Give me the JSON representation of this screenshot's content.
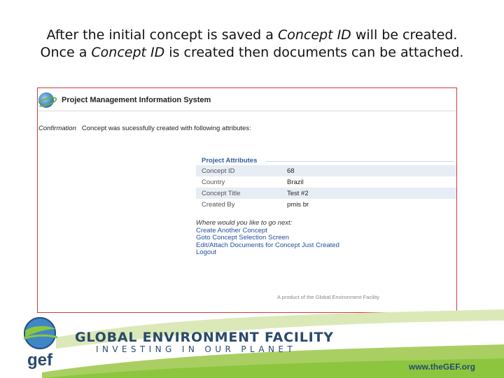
{
  "caption": {
    "line1_before": "After the initial concept is saved a ",
    "line1_em": "Concept ID",
    "line1_after": " will be created.",
    "line2_before": "Once a ",
    "line2_em": "Concept ID",
    "line2_after": " is created then documents can be attached."
  },
  "app": {
    "title": "Project Management Information System",
    "logo_icon": "globe-icon"
  },
  "confirmation": {
    "label": "Confirmation",
    "message": "Concept was sucessfully created with following attributes:"
  },
  "attributes": {
    "legend": "Project Attributes",
    "rows": [
      {
        "key": "Concept ID",
        "value": "68"
      },
      {
        "key": "Country",
        "value": "Brazil"
      },
      {
        "key": "Concept Title",
        "value": "Test #2"
      },
      {
        "key": "Created By",
        "value": "pmis br"
      }
    ]
  },
  "next_steps": {
    "question": "Where would you like to go next:",
    "links": [
      "Create Another Concept",
      "Goto Concept Selection Screen",
      "Edit/Attach Documents for Concept Just Created",
      "Logout"
    ]
  },
  "footer_note": "A product of the Global Environment Facility",
  "branding": {
    "name": "GLOBAL ENVIRONMENT FACILITY",
    "tagline": "INVESTING IN OUR PLANET",
    "logo_text": "gef",
    "url": "www.theGEF.org"
  },
  "colors": {
    "frame_border": "#d23b3b",
    "link": "#1f4f9c",
    "brand_navy": "#2a4a6b",
    "brand_green": "#8cc63f"
  }
}
